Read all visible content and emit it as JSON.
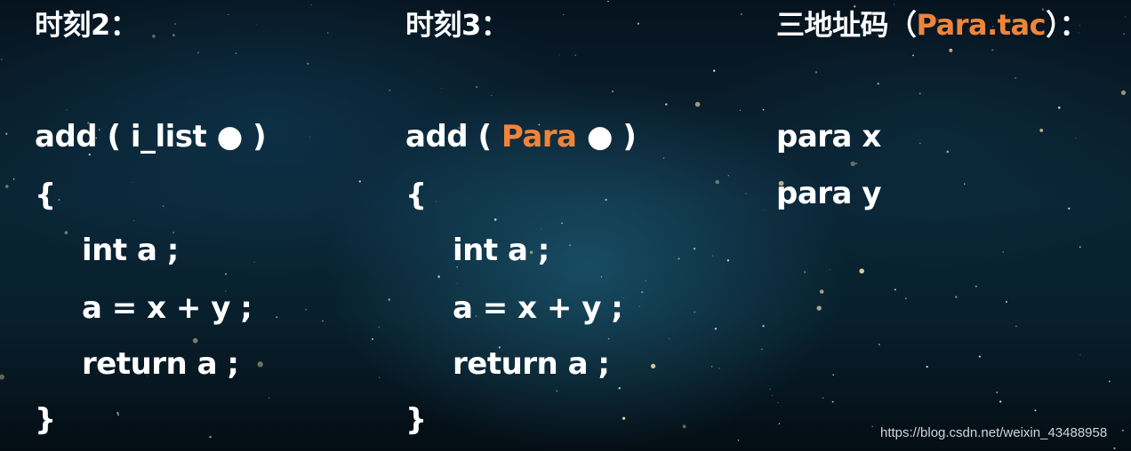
{
  "slide": {
    "col1": {
      "heading": "时刻2：",
      "sig_open": "add ( i_list ● )",
      "brace_open": "{",
      "body": [
        "int a ;",
        "a = x + y ;",
        "return a ;"
      ],
      "brace_close": "}"
    },
    "col2": {
      "heading": "时刻3：",
      "sig_prefix": "add ( ",
      "sig_highlight": "Para",
      "sig_suffix": " ● )",
      "brace_open": "{",
      "body": [
        "int a ;",
        "a = x + y ;",
        "return a ;"
      ],
      "brace_close": "}"
    },
    "col3": {
      "heading_prefix": "三地址码（",
      "heading_highlight": "Para.tac",
      "heading_suffix": "）：",
      "lines": [
        "para x",
        "para y"
      ]
    },
    "highlight_color": "#f0843a",
    "text_color": "#ffffff"
  },
  "watermark": "https://blog.csdn.net/weixin_43488958"
}
